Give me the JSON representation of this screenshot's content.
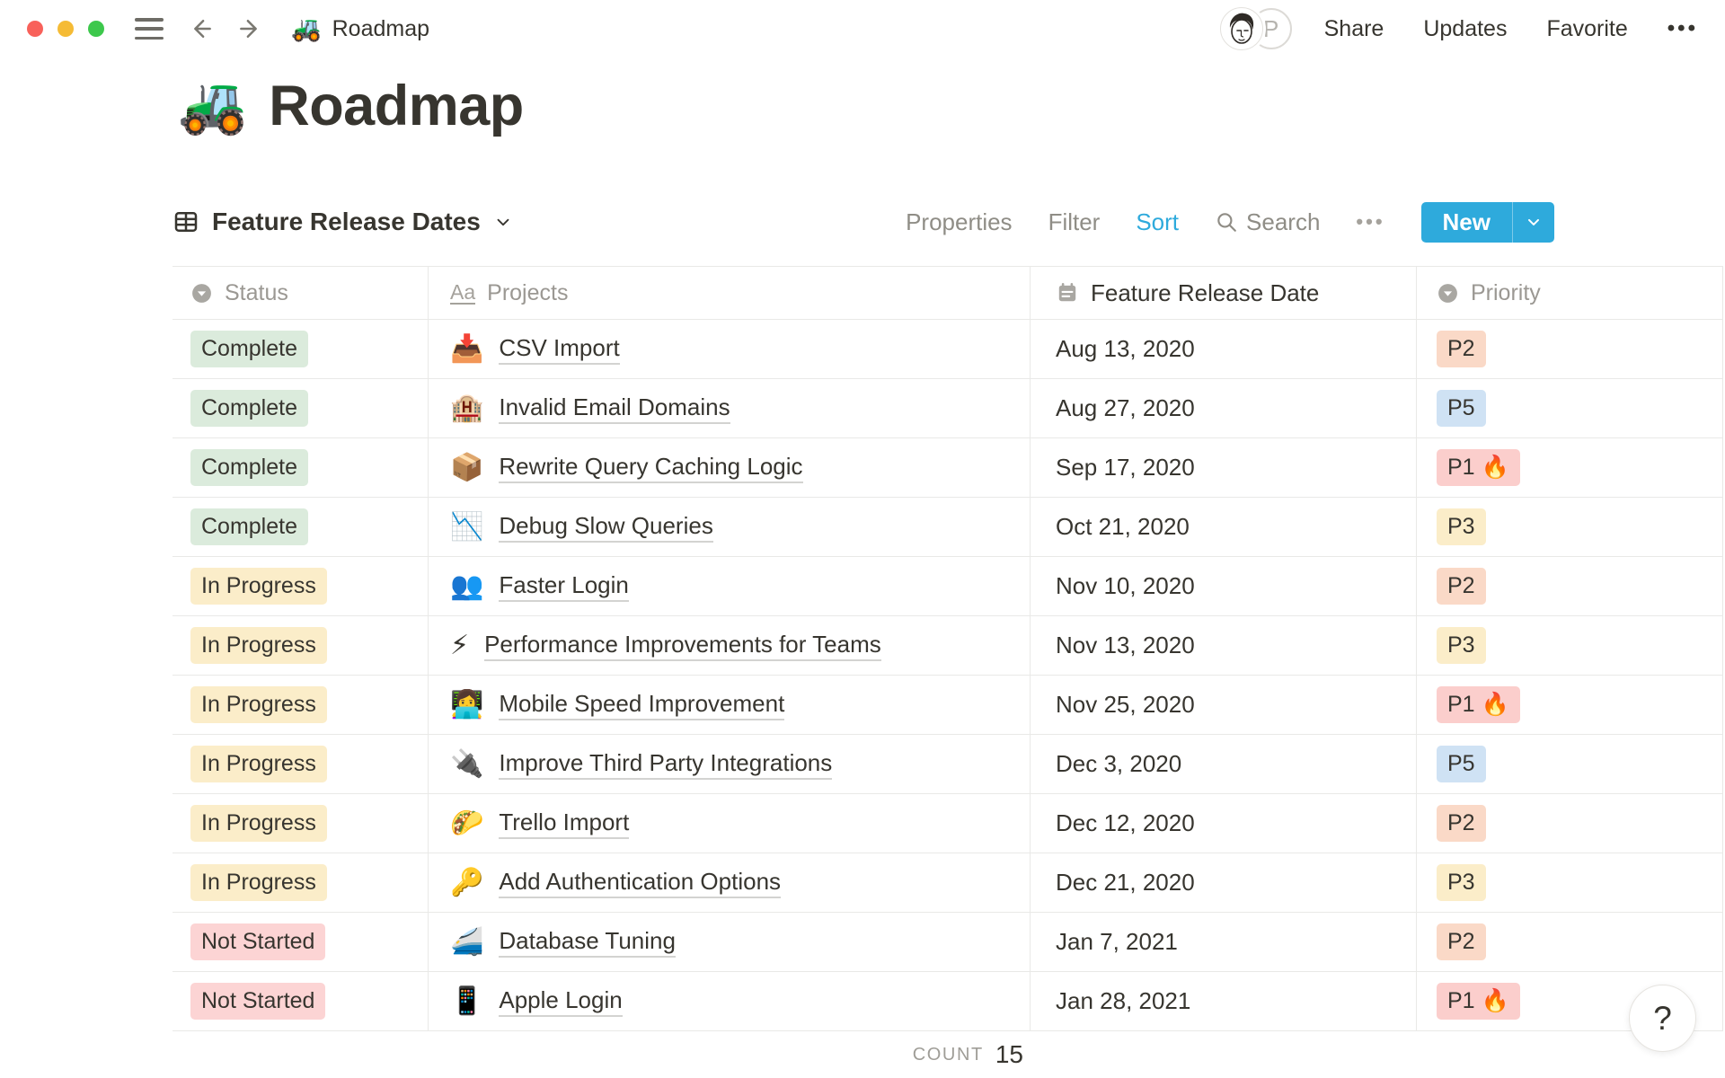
{
  "topbar": {
    "doc_emoji": "🚜",
    "doc_title": "Roadmap",
    "avatar_initial": "P",
    "share": "Share",
    "updates": "Updates",
    "favorite": "Favorite",
    "more": "•••"
  },
  "page": {
    "emoji": "🚜",
    "title": "Roadmap"
  },
  "toolbar": {
    "view_name": "Feature Release Dates",
    "properties": "Properties",
    "filter": "Filter",
    "sort": "Sort",
    "search": "Search",
    "more": "•••",
    "new_label": "New"
  },
  "table": {
    "header": {
      "status": "Status",
      "projects": "Projects",
      "date": "Feature Release Date",
      "priority": "Priority"
    },
    "rows": [
      {
        "status": "Complete",
        "status_color": "green",
        "emoji": "📥",
        "project": "CSV Import",
        "date": "Aug 13, 2020",
        "priority": "P2",
        "priority_color": "peach"
      },
      {
        "status": "Complete",
        "status_color": "green",
        "emoji": "🏨",
        "project": "Invalid Email Domains",
        "date": "Aug 27, 2020",
        "priority": "P5",
        "priority_color": "blue"
      },
      {
        "status": "Complete",
        "status_color": "green",
        "emoji": "📦",
        "project": "Rewrite Query Caching Logic",
        "date": "Sep 17, 2020",
        "priority": "P1 🔥",
        "priority_color": "red"
      },
      {
        "status": "Complete",
        "status_color": "green",
        "emoji": "📉",
        "project": "Debug Slow Queries",
        "date": "Oct 21, 2020",
        "priority": "P3",
        "priority_color": "yellow"
      },
      {
        "status": "In Progress",
        "status_color": "yellow",
        "emoji": "👥",
        "project": "Faster Login",
        "date": "Nov 10, 2020",
        "priority": "P2",
        "priority_color": "peach"
      },
      {
        "status": "In Progress",
        "status_color": "yellow",
        "emoji": "⚡",
        "project": "Performance Improvements for Teams",
        "date": "Nov 13, 2020",
        "priority": "P3",
        "priority_color": "yellow"
      },
      {
        "status": "In Progress",
        "status_color": "yellow",
        "emoji": "👩‍💻",
        "project": "Mobile Speed Improvement",
        "date": "Nov 25, 2020",
        "priority": "P1 🔥",
        "priority_color": "red"
      },
      {
        "status": "In Progress",
        "status_color": "yellow",
        "emoji": "🔌",
        "project": "Improve Third Party Integrations",
        "date": "Dec 3, 2020",
        "priority": "P5",
        "priority_color": "blue"
      },
      {
        "status": "In Progress",
        "status_color": "yellow",
        "emoji": "🌮",
        "project": "Trello Import",
        "date": "Dec 12, 2020",
        "priority": "P2",
        "priority_color": "peach"
      },
      {
        "status": "In Progress",
        "status_color": "yellow",
        "emoji": "🔑",
        "project": "Add Authentication Options",
        "date": "Dec 21, 2020",
        "priority": "P3",
        "priority_color": "yellow"
      },
      {
        "status": "Not Started",
        "status_color": "pink",
        "emoji": "🚄",
        "project": "Database Tuning",
        "date": "Jan 7, 2021",
        "priority": "P2",
        "priority_color": "peach"
      },
      {
        "status": "Not Started",
        "status_color": "pink",
        "emoji": "📱",
        "project": "Apple Login",
        "date": "Jan 28, 2021",
        "priority": "P1 🔥",
        "priority_color": "red"
      }
    ],
    "footer": {
      "label": "COUNT",
      "value": "15"
    }
  },
  "help_label": "?",
  "colors": {
    "accent_blue": "#2EAADC",
    "tag_green": "#DBEBDC",
    "tag_yellow": "#FBEDC9",
    "tag_pink": "#FCD4D4",
    "tag_red": "#FBCECC",
    "tag_peach": "#FAD9C7",
    "tag_blue": "#CFE2F4"
  }
}
